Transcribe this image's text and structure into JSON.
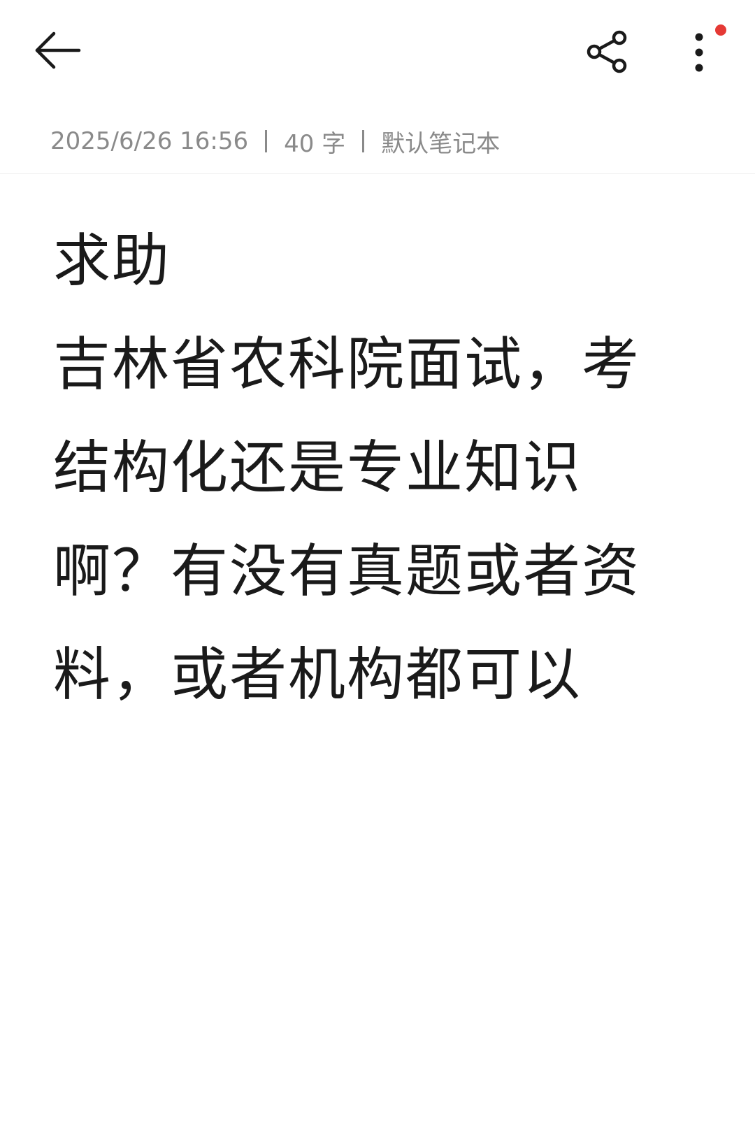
{
  "toolbar": {
    "back_icon": "arrow-left-icon",
    "share_icon": "share-icon",
    "more_icon": "more-vertical-icon",
    "notification_color": "#e53935"
  },
  "meta": {
    "datetime": "2025/6/26 16:56",
    "word_count": "40 字",
    "notebook": "默认笔记本"
  },
  "note": {
    "title": "求助",
    "body": "吉林省农科院面试，考结构化还是专业知识啊？有没有真题或者资料，或者机构都可以"
  }
}
